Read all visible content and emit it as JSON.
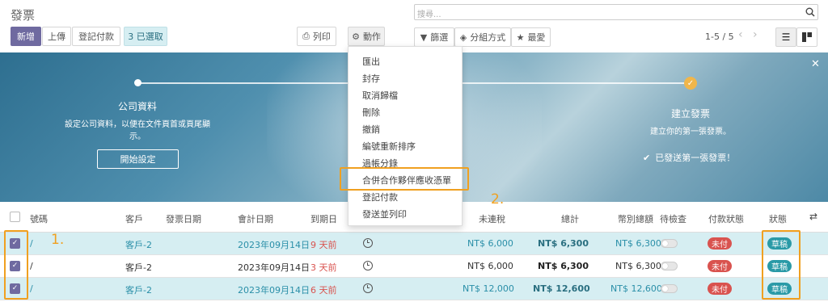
{
  "header": {
    "title": "發票",
    "search_placeholder": "搜尋..."
  },
  "toolbar": {
    "new_label": "新增",
    "upload_label": "上傳",
    "register_payment_label": "登記付款",
    "selected_label": "3 已選取",
    "print_label": "列印",
    "action_label": "動作",
    "filter_label": "篩選",
    "group_label": "分組方式",
    "favorite_label": "最愛",
    "pager": "1-5 / 5"
  },
  "action_menu": {
    "items": [
      "匯出",
      "封存",
      "取消歸檔",
      "刪除",
      "撤銷",
      "編號重新排序",
      "過帳分錄",
      "合併合作夥伴應收憑單",
      "登記付款",
      "發送並列印"
    ]
  },
  "banner": {
    "step1_title": "公司資料",
    "step1_desc_line1": "設定公司資料，以便在文件頁首或頁尾顯",
    "step1_desc_line2": "示。",
    "step1_button": "開始設定",
    "step2_title": "建立發票",
    "step2_desc": "建立你的第一張發票。",
    "step2_done": "已發送第一張發票！"
  },
  "table": {
    "headers": [
      "號碼",
      "客戶",
      "發票日期",
      "會計日期",
      "到期日",
      "未連稅",
      "總計",
      "幣別總額",
      "待檢查",
      "付款狀態",
      "狀態"
    ],
    "rows": [
      {
        "number": "/",
        "customer": "客戶-2",
        "invoice_date": "",
        "accounting_date": "2023年09月14日",
        "due": "9 天前",
        "untaxed": "NT$ 6,000",
        "total": "NT$ 6,300",
        "currency_total": "NT$ 6,300",
        "payment_status": "未付",
        "state": "草稿"
      },
      {
        "number": "/",
        "customer": "客戶-2",
        "invoice_date": "",
        "accounting_date": "2023年09月14日",
        "due": "3 天前",
        "untaxed": "NT$ 6,000",
        "total": "NT$ 6,300",
        "currency_total": "NT$ 6,300",
        "payment_status": "未付",
        "state": "草稿"
      },
      {
        "number": "/",
        "customer": "客戶-2",
        "invoice_date": "",
        "accounting_date": "2023年09月14日",
        "due": "6 天前",
        "untaxed": "NT$ 12,000",
        "total": "NT$ 12,600",
        "currency_total": "NT$ 12,600",
        "payment_status": "未付",
        "state": "草稿"
      }
    ]
  },
  "annotations": {
    "label1": "1.",
    "label2": "2."
  },
  "colors": {
    "primary": "#6f6aa0",
    "teal": "#2a9aa7",
    "link": "#2a8fa8",
    "danger": "#d9534f",
    "highlight": "#f0a020",
    "selected_row": "#d6eef2"
  }
}
